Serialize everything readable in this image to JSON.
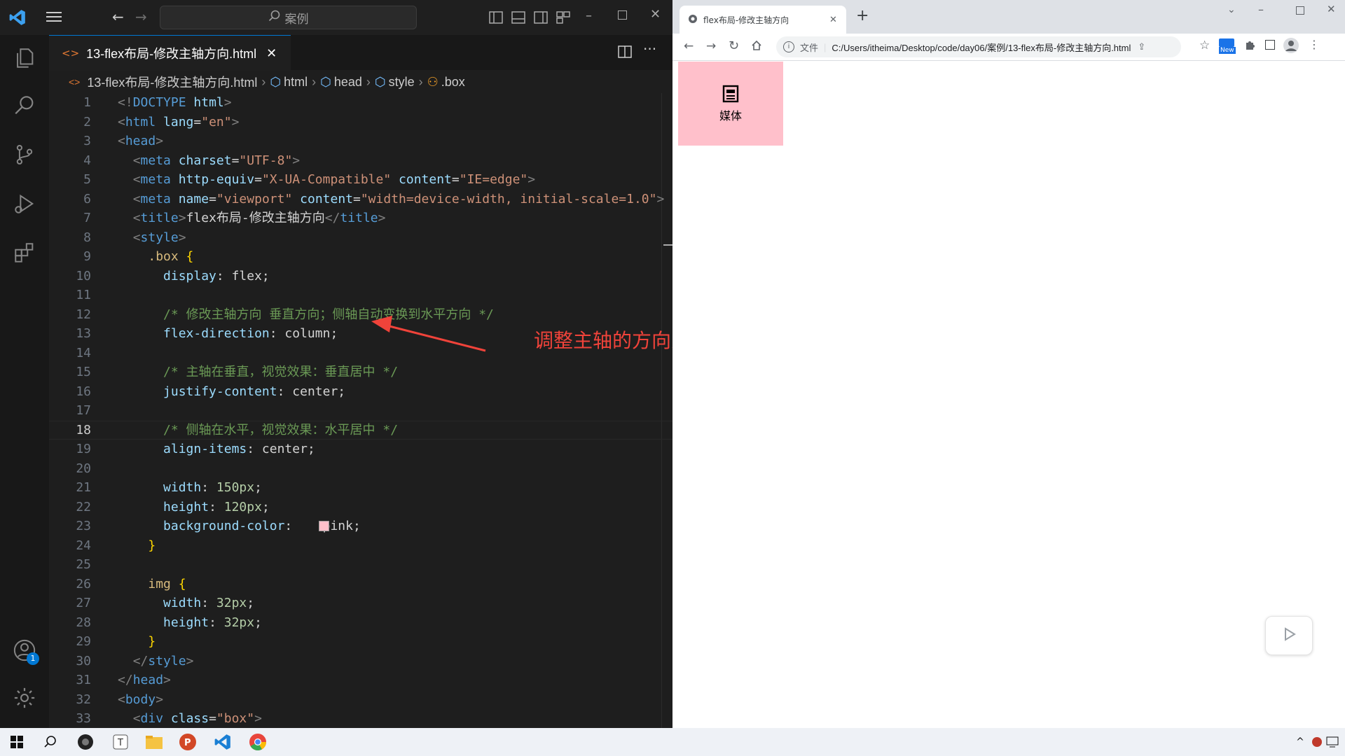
{
  "vscode": {
    "search_placeholder": "案例",
    "tab_label": "13-flex布局-修改主轴方向.html",
    "breadcrumb": [
      "13-flex布局-修改主轴方向.html",
      "html",
      "head",
      "style",
      ".box"
    ],
    "account_badge": "1",
    "current_line": "18"
  },
  "code_lines": [
    {
      "n": "1",
      "parts": [
        [
          "t-br",
          "<!"
        ],
        [
          "t-tag",
          "DOCTYPE "
        ],
        [
          "t-at",
          "html"
        ],
        [
          "t-br",
          ">"
        ]
      ]
    },
    {
      "n": "2",
      "parts": [
        [
          "t-br",
          "<"
        ],
        [
          "t-tag",
          "html "
        ],
        [
          "t-at",
          "lang"
        ],
        [
          "t-txt",
          "="
        ],
        [
          "t-str",
          "\"en\""
        ],
        [
          "t-br",
          ">"
        ]
      ]
    },
    {
      "n": "3",
      "parts": [
        [
          "t-br",
          "<"
        ],
        [
          "t-tag",
          "head"
        ],
        [
          "t-br",
          ">"
        ]
      ]
    },
    {
      "n": "4",
      "parts": [
        [
          "t-txt",
          "  "
        ],
        [
          "t-br",
          "<"
        ],
        [
          "t-tag",
          "meta "
        ],
        [
          "t-at",
          "charset"
        ],
        [
          "t-txt",
          "="
        ],
        [
          "t-str",
          "\"UTF-8\""
        ],
        [
          "t-br",
          ">"
        ]
      ]
    },
    {
      "n": "5",
      "parts": [
        [
          "t-txt",
          "  "
        ],
        [
          "t-br",
          "<"
        ],
        [
          "t-tag",
          "meta "
        ],
        [
          "t-at",
          "http-equiv"
        ],
        [
          "t-txt",
          "="
        ],
        [
          "t-str",
          "\"X-UA-Compatible\" "
        ],
        [
          "t-at",
          "content"
        ],
        [
          "t-txt",
          "="
        ],
        [
          "t-str",
          "\"IE=edge\""
        ],
        [
          "t-br",
          ">"
        ]
      ]
    },
    {
      "n": "6",
      "parts": [
        [
          "t-txt",
          "  "
        ],
        [
          "t-br",
          "<"
        ],
        [
          "t-tag",
          "meta "
        ],
        [
          "t-at",
          "name"
        ],
        [
          "t-txt",
          "="
        ],
        [
          "t-str",
          "\"viewport\" "
        ],
        [
          "t-at",
          "content"
        ],
        [
          "t-txt",
          "="
        ],
        [
          "t-str",
          "\"width=device-width, initial-scale=1.0\""
        ],
        [
          "t-br",
          ">"
        ]
      ]
    },
    {
      "n": "7",
      "parts": [
        [
          "t-txt",
          "  "
        ],
        [
          "t-br",
          "<"
        ],
        [
          "t-tag",
          "title"
        ],
        [
          "t-br",
          ">"
        ],
        [
          "t-txt",
          "flex布局-修改主轴方向"
        ],
        [
          "t-br",
          "</"
        ],
        [
          "t-tag",
          "title"
        ],
        [
          "t-br",
          ">"
        ]
      ]
    },
    {
      "n": "8",
      "parts": [
        [
          "t-txt",
          "  "
        ],
        [
          "t-br",
          "<"
        ],
        [
          "t-tag",
          "style"
        ],
        [
          "t-br",
          ">"
        ]
      ]
    },
    {
      "n": "9",
      "parts": [
        [
          "t-txt",
          "    "
        ],
        [
          "t-sel",
          ".box "
        ],
        [
          "t-brace",
          "{"
        ]
      ]
    },
    {
      "n": "10",
      "parts": [
        [
          "t-txt",
          "      "
        ],
        [
          "t-prop",
          "display"
        ],
        [
          "t-txt",
          ": flex;"
        ]
      ]
    },
    {
      "n": "11",
      "parts": []
    },
    {
      "n": "12",
      "parts": [
        [
          "t-txt",
          "      "
        ],
        [
          "t-com",
          "/* 修改主轴方向 垂直方向；侧轴自动变换到水平方向 */"
        ]
      ]
    },
    {
      "n": "13",
      "parts": [
        [
          "t-txt",
          "      "
        ],
        [
          "t-prop",
          "flex-direction"
        ],
        [
          "t-txt",
          ": column;"
        ]
      ]
    },
    {
      "n": "14",
      "parts": []
    },
    {
      "n": "15",
      "parts": [
        [
          "t-txt",
          "      "
        ],
        [
          "t-com",
          "/* 主轴在垂直，视觉效果：垂直居中 */"
        ]
      ]
    },
    {
      "n": "16",
      "parts": [
        [
          "t-txt",
          "      "
        ],
        [
          "t-prop",
          "justify-content"
        ],
        [
          "t-txt",
          ": center;"
        ]
      ]
    },
    {
      "n": "17",
      "parts": []
    },
    {
      "n": "18",
      "parts": [
        [
          "t-txt",
          "      "
        ],
        [
          "t-com",
          "/* 侧轴在水平，视觉效果：水平居中 */"
        ]
      ]
    },
    {
      "n": "19",
      "parts": [
        [
          "t-txt",
          "      "
        ],
        [
          "t-prop",
          "align-items"
        ],
        [
          "t-txt",
          ": center;"
        ]
      ]
    },
    {
      "n": "20",
      "parts": []
    },
    {
      "n": "21",
      "parts": [
        [
          "t-txt",
          "      "
        ],
        [
          "t-prop",
          "width"
        ],
        [
          "t-txt",
          ": "
        ],
        [
          "t-num",
          "150px"
        ],
        [
          "t-txt",
          ";"
        ]
      ]
    },
    {
      "n": "22",
      "parts": [
        [
          "t-txt",
          "      "
        ],
        [
          "t-prop",
          "height"
        ],
        [
          "t-txt",
          ": "
        ],
        [
          "t-num",
          "120px"
        ],
        [
          "t-txt",
          ";"
        ]
      ]
    },
    {
      "n": "23",
      "parts": [
        [
          "t-txt",
          "      "
        ],
        [
          "t-prop",
          "background-color"
        ],
        [
          "t-txt",
          ": "
        ],
        [
          "t-txt",
          "   pink;"
        ]
      ]
    },
    {
      "n": "24",
      "parts": [
        [
          "t-txt",
          "    "
        ],
        [
          "t-brace",
          "}"
        ]
      ]
    },
    {
      "n": "25",
      "parts": []
    },
    {
      "n": "26",
      "parts": [
        [
          "t-txt",
          "    "
        ],
        [
          "t-sel",
          "img "
        ],
        [
          "t-brace",
          "{"
        ]
      ]
    },
    {
      "n": "27",
      "parts": [
        [
          "t-txt",
          "      "
        ],
        [
          "t-prop",
          "width"
        ],
        [
          "t-txt",
          ": "
        ],
        [
          "t-num",
          "32px"
        ],
        [
          "t-txt",
          ";"
        ]
      ]
    },
    {
      "n": "28",
      "parts": [
        [
          "t-txt",
          "      "
        ],
        [
          "t-prop",
          "height"
        ],
        [
          "t-txt",
          ": "
        ],
        [
          "t-num",
          "32px"
        ],
        [
          "t-txt",
          ";"
        ]
      ]
    },
    {
      "n": "29",
      "parts": [
        [
          "t-txt",
          "    "
        ],
        [
          "t-brace",
          "}"
        ]
      ]
    },
    {
      "n": "30",
      "parts": [
        [
          "t-txt",
          "  "
        ],
        [
          "t-br",
          "</"
        ],
        [
          "t-tag",
          "style"
        ],
        [
          "t-br",
          ">"
        ]
      ]
    },
    {
      "n": "31",
      "parts": [
        [
          "t-br",
          "</"
        ],
        [
          "t-tag",
          "head"
        ],
        [
          "t-br",
          ">"
        ]
      ]
    },
    {
      "n": "32",
      "parts": [
        [
          "t-br",
          "<"
        ],
        [
          "t-tag",
          "body"
        ],
        [
          "t-br",
          ">"
        ]
      ]
    },
    {
      "n": "33",
      "parts": [
        [
          "t-txt",
          "  "
        ],
        [
          "t-br",
          "<"
        ],
        [
          "t-tag",
          "div "
        ],
        [
          "t-at",
          "class"
        ],
        [
          "t-txt",
          "="
        ],
        [
          "t-str",
          "\"box\""
        ],
        [
          "t-br",
          ">"
        ]
      ]
    }
  ],
  "annotation": "调整主轴的方向为垂直方向",
  "browser": {
    "tab_title": "flex布局-修改主轴方向",
    "address_prefix": "文件",
    "url": "C:/Users/itheima/Desktop/code/day06/案例/13-flex布局-修改主轴方向.html",
    "new_badge": "New",
    "box_label": "媒体"
  },
  "colors": {
    "accent": "#0078d4",
    "annotation": "#f0433a",
    "box_bg": "pink"
  }
}
